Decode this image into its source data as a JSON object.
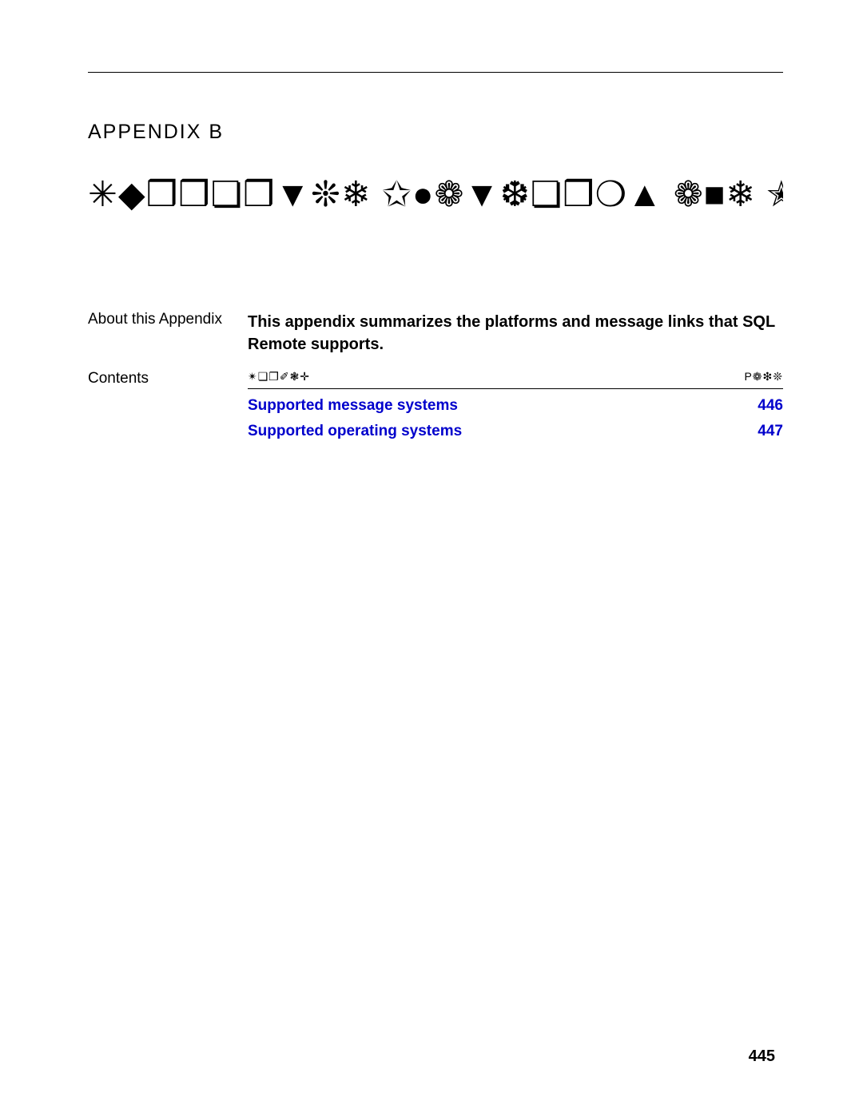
{
  "appendix_label": "APPENDIX B",
  "symbol_title": "✳◆❒❒❏❒▼❊❄ ✩●❁▼❆❏❒❍▲ ❁■❄ ✭❊▲▲❁❇",
  "about": {
    "label": "About this Appendix",
    "text": "This appendix summarizes the platforms and message links that SQL Remote supports."
  },
  "contents": {
    "label": "Contents",
    "header_title": "✴❏❐✐❃✛",
    "header_page": "P❁❇❊",
    "items": [
      {
        "title": "Supported message systems",
        "page": "446"
      },
      {
        "title": "Supported operating systems",
        "page": "447"
      }
    ]
  },
  "page_number": "445"
}
